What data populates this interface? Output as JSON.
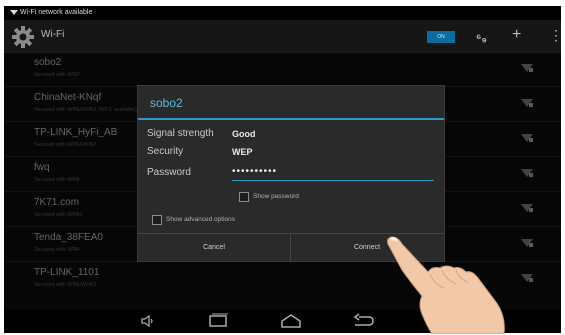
{
  "status_bar": {
    "notification": "Wi-Fi network available"
  },
  "action_bar": {
    "title": "Wi-Fi",
    "toggle_label": "ON"
  },
  "networks": [
    {
      "name": "sobo2",
      "security": "Secured with WEP"
    },
    {
      "name": "ChinaNet-KNqf",
      "security": "Secured with WPA/WPA2 (WPS available)"
    },
    {
      "name": "TP-LINK_HyFi_AB",
      "security": "Secured with WPA/WPA2"
    },
    {
      "name": "fwq",
      "security": "Secured with WPA"
    },
    {
      "name": "7K71.com",
      "security": "Secured with WPA2"
    },
    {
      "name": "Tenda_38FEA0",
      "security": "Secured with WPA"
    },
    {
      "name": "TP-LINK_1101",
      "security": "Secured with WPA/WPA2"
    }
  ],
  "dialog": {
    "title": "sobo2",
    "signal_label": "Signal strength",
    "signal_value": "Good",
    "security_label": "Security",
    "security_value": "WEP",
    "password_label": "Password",
    "password_value": "••••••••••",
    "show_password_label": "Show password",
    "show_advanced_label": "Show advanced options",
    "cancel_label": "Cancel",
    "connect_label": "Connect"
  },
  "colors": {
    "accent": "#2e97c7",
    "background": "#0a0a0a",
    "dialog": "#2a2a2a"
  }
}
